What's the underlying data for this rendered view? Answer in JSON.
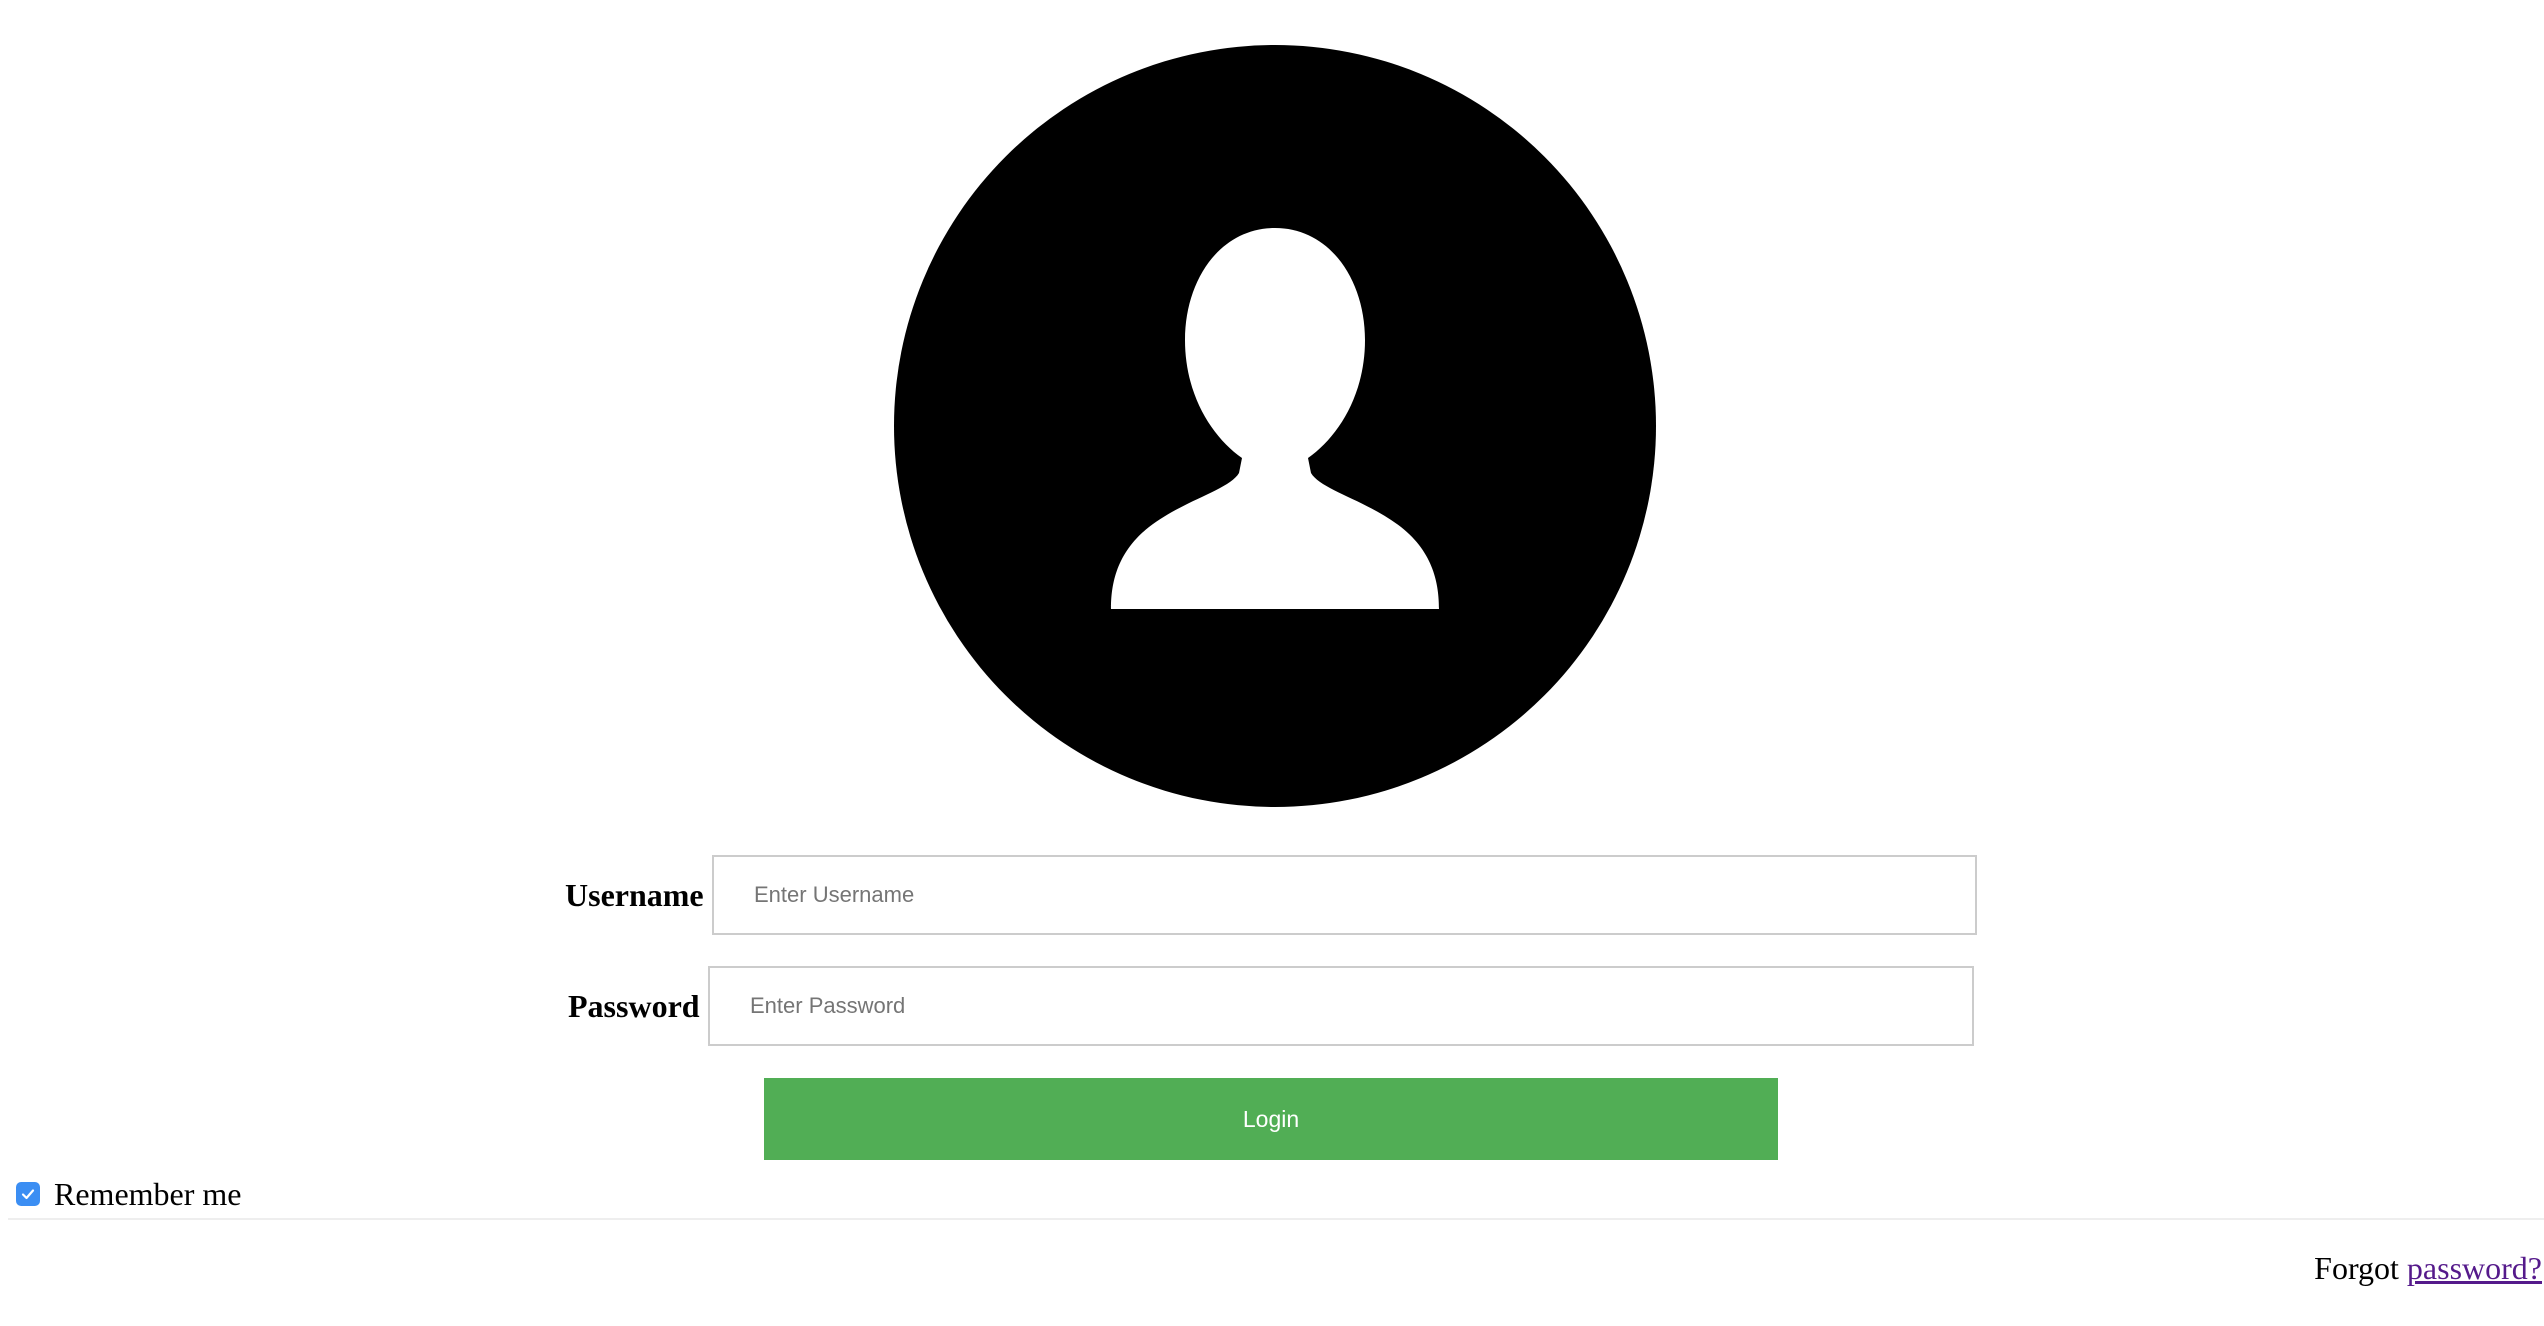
{
  "avatar": {
    "icon": "user-silhouette-icon"
  },
  "form": {
    "username_label": "Username",
    "username_placeholder": "Enter Username",
    "username_value": "",
    "password_label": "Password",
    "password_placeholder": "Enter Password",
    "password_value": "",
    "login_label": "Login",
    "remember_label": "Remember me",
    "remember_checked": true
  },
  "footer": {
    "forgot_prefix": "Forgot ",
    "forgot_link": "password?"
  },
  "colors": {
    "login_button": "#51ae55",
    "checkbox": "#3b8ef3",
    "link_visited": "#551a8b",
    "avatar": "#000000"
  }
}
